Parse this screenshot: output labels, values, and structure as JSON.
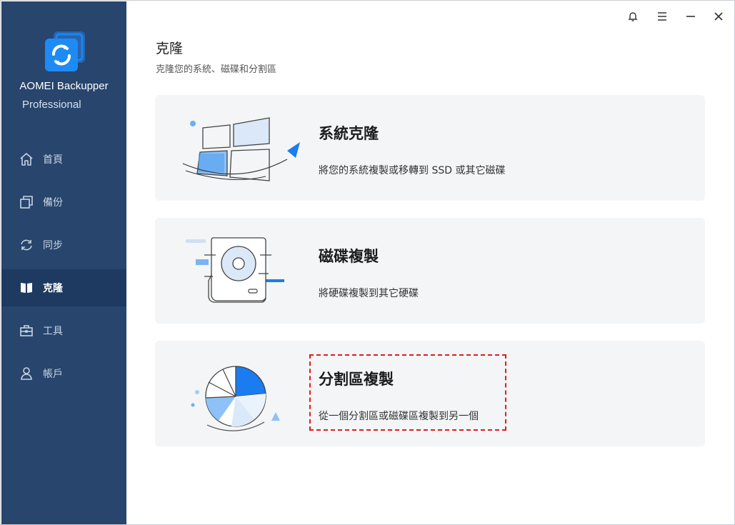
{
  "app": {
    "name": "AOMEI Backupper",
    "edition": "Professional"
  },
  "window_controls": {
    "notification_icon": "bell-icon",
    "menu_icon": "menu-icon",
    "minimize_icon": "minimize-icon",
    "close_icon": "close-icon"
  },
  "sidebar": {
    "items": [
      {
        "label": "首頁",
        "icon": "home-icon",
        "active": false
      },
      {
        "label": "備份",
        "icon": "backup-icon",
        "active": false
      },
      {
        "label": "同步",
        "icon": "sync-icon",
        "active": false
      },
      {
        "label": "克隆",
        "icon": "clone-icon",
        "active": true
      },
      {
        "label": "工具",
        "icon": "toolbox-icon",
        "active": false
      },
      {
        "label": "帳戶",
        "icon": "user-icon",
        "active": false
      }
    ]
  },
  "page": {
    "title": "克隆",
    "subtitle": "克隆您的系統、磁碟和分割區"
  },
  "cards": [
    {
      "title": "系統克隆",
      "desc": "將您的系統複製或移轉到 SSD 或其它磁碟",
      "icon": "windows-system-icon"
    },
    {
      "title": "磁碟複製",
      "desc": "將硬碟複製到其它硬碟",
      "icon": "hard-disk-icon"
    },
    {
      "title": "分割區複製",
      "desc": "從一個分割區或磁碟區複製到另一個",
      "icon": "partition-pie-icon"
    }
  ],
  "colors": {
    "sidebar_bg": "#27456d",
    "sidebar_active": "#1e3a60",
    "accent": "#1a7cf0",
    "card_bg": "#f3f5f7",
    "highlight": "#e01b1b"
  }
}
